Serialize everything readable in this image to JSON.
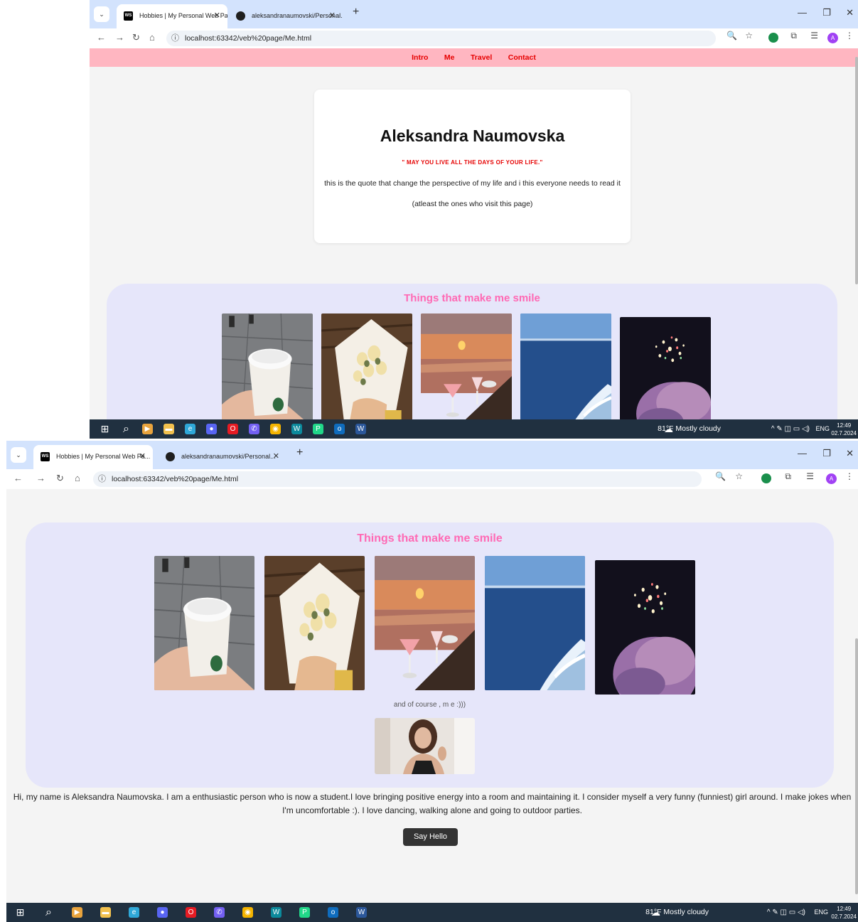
{
  "browser": {
    "tabs": [
      {
        "title": "Hobbies | My Personal Web Pa...",
        "active": true
      },
      {
        "title": "aleksandranaumovski/Personal...",
        "active": false
      }
    ],
    "address": "localhost:63342/veb%20page/Me.html",
    "avatar_letter": "A"
  },
  "nav": {
    "items": [
      "Intro",
      "Me",
      "Travel",
      "Contact"
    ]
  },
  "intro": {
    "name": "Aleksandra Naumovska",
    "quote": "\" MAY YOU LIVE ALL THE DAYS OF YOUR LIFE.\"",
    "text1": "this is the quote that change the perspective of my life and i this everyone needs to read it",
    "text2": "(atleast the ones who visit this page)"
  },
  "smile": {
    "title": "Things that make me smile",
    "photos": [
      "coffee",
      "flowers",
      "sunset-cocktail",
      "sea",
      "fireworks"
    ],
    "and_course": "and of course , m e :)))"
  },
  "about": {
    "text": "Hi, my name is Aleksandra Naumovska. I am a enthusiastic person who is now a student.I love bringing positive energy into a room and maintaining it. I consider myself a very funny (funniest) girl around. I make jokes when I'm uncomfortable :). I love dancing, walking alone and going to outdoor parties.",
    "button": "Say Hello"
  },
  "taskbar": {
    "weather_temp": "81°F",
    "weather_text": "Mostly cloudy",
    "language": "ENG",
    "time": "12:49",
    "date": "02.7.2024"
  },
  "colors": {
    "navbar": "#ffb6c1",
    "nav_link": "#e60000",
    "smile_bg": "#e6e6fa",
    "smile_title": "#ff69b4"
  }
}
